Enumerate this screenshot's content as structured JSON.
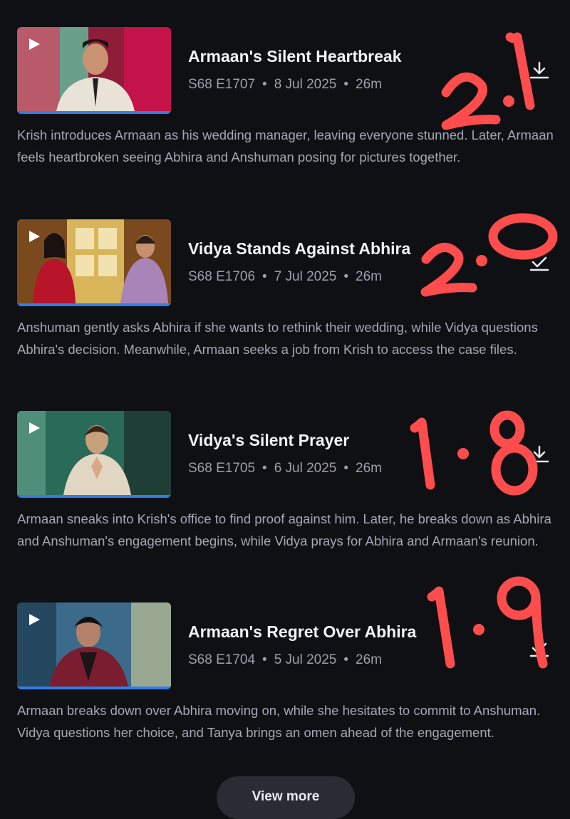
{
  "episodes": [
    {
      "title": "Armaan's Silent Heartbreak",
      "code": "S68 E1707",
      "date": "8 Jul 2025",
      "duration": "26m",
      "progress": 1.0,
      "rating_scribble": "2.1",
      "description": "Krish introduces Armaan as his wedding manager, leaving everyone stunned. Later, Armaan feels heartbroken seeing Abhira and Anshuman posing for pictures together."
    },
    {
      "title": "Vidya Stands Against Abhira",
      "code": "S68 E1706",
      "date": "7 Jul 2025",
      "duration": "26m",
      "progress": 1.0,
      "rating_scribble": "2.0",
      "description": "Anshuman gently asks Abhira if she wants to rethink their wedding, while Vidya questions Abhira's decision. Meanwhile, Armaan seeks a job from Krish to access the case files."
    },
    {
      "title": "Vidya's Silent Prayer",
      "code": "S68 E1705",
      "date": "6 Jul 2025",
      "duration": "26m",
      "progress": 1.0,
      "rating_scribble": "1.8",
      "description": "Armaan sneaks into Krish's office to find proof against him. Later, he breaks down as Abhira and Anshuman's engagement begins, while Vidya prays for Abhira and Armaan's reunion."
    },
    {
      "title": "Armaan's Regret Over Abhira",
      "code": "S68 E1704",
      "date": "5 Jul 2025",
      "duration": "26m",
      "progress": 1.0,
      "rating_scribble": "1.9",
      "description": "Armaan breaks down over Abhira moving on, while she hesitates to commit to Anshuman. Vidya questions her choice, and Tanya brings an omen ahead of the engagement."
    }
  ],
  "separator": "•",
  "view_more_label": "View more",
  "colors": {
    "background": "#0f1014",
    "progress": "#2f7ee8",
    "scribble": "#ff4d4d"
  },
  "icons": {
    "play": "play-icon",
    "download": "download-icon",
    "downloaded": "downloaded-check-icon"
  }
}
